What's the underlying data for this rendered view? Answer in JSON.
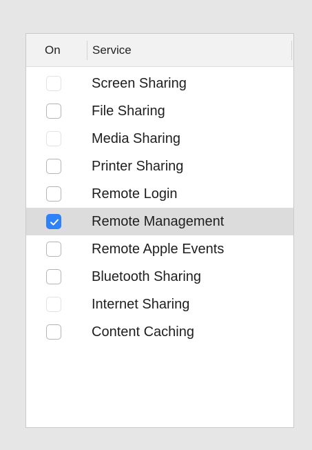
{
  "table": {
    "columns": {
      "on": "On",
      "service": "Service"
    },
    "rows": [
      {
        "label": "Screen Sharing",
        "checked": false,
        "enabled": false,
        "selected": false
      },
      {
        "label": "File Sharing",
        "checked": false,
        "enabled": true,
        "selected": false
      },
      {
        "label": "Media Sharing",
        "checked": false,
        "enabled": false,
        "selected": false
      },
      {
        "label": "Printer Sharing",
        "checked": false,
        "enabled": true,
        "selected": false
      },
      {
        "label": "Remote Login",
        "checked": false,
        "enabled": true,
        "selected": false
      },
      {
        "label": "Remote Management",
        "checked": true,
        "enabled": true,
        "selected": true
      },
      {
        "label": "Remote Apple Events",
        "checked": false,
        "enabled": true,
        "selected": false
      },
      {
        "label": "Bluetooth Sharing",
        "checked": false,
        "enabled": true,
        "selected": false
      },
      {
        "label": "Internet Sharing",
        "checked": false,
        "enabled": false,
        "selected": false
      },
      {
        "label": "Content Caching",
        "checked": false,
        "enabled": true,
        "selected": false
      }
    ]
  },
  "colors": {
    "checkbox_checked": "#2f81f7",
    "selected_row": "#dcdcdc",
    "header_background": "#f2f2f2"
  },
  "icons": {
    "checkbox_check": "checkmark-icon"
  }
}
